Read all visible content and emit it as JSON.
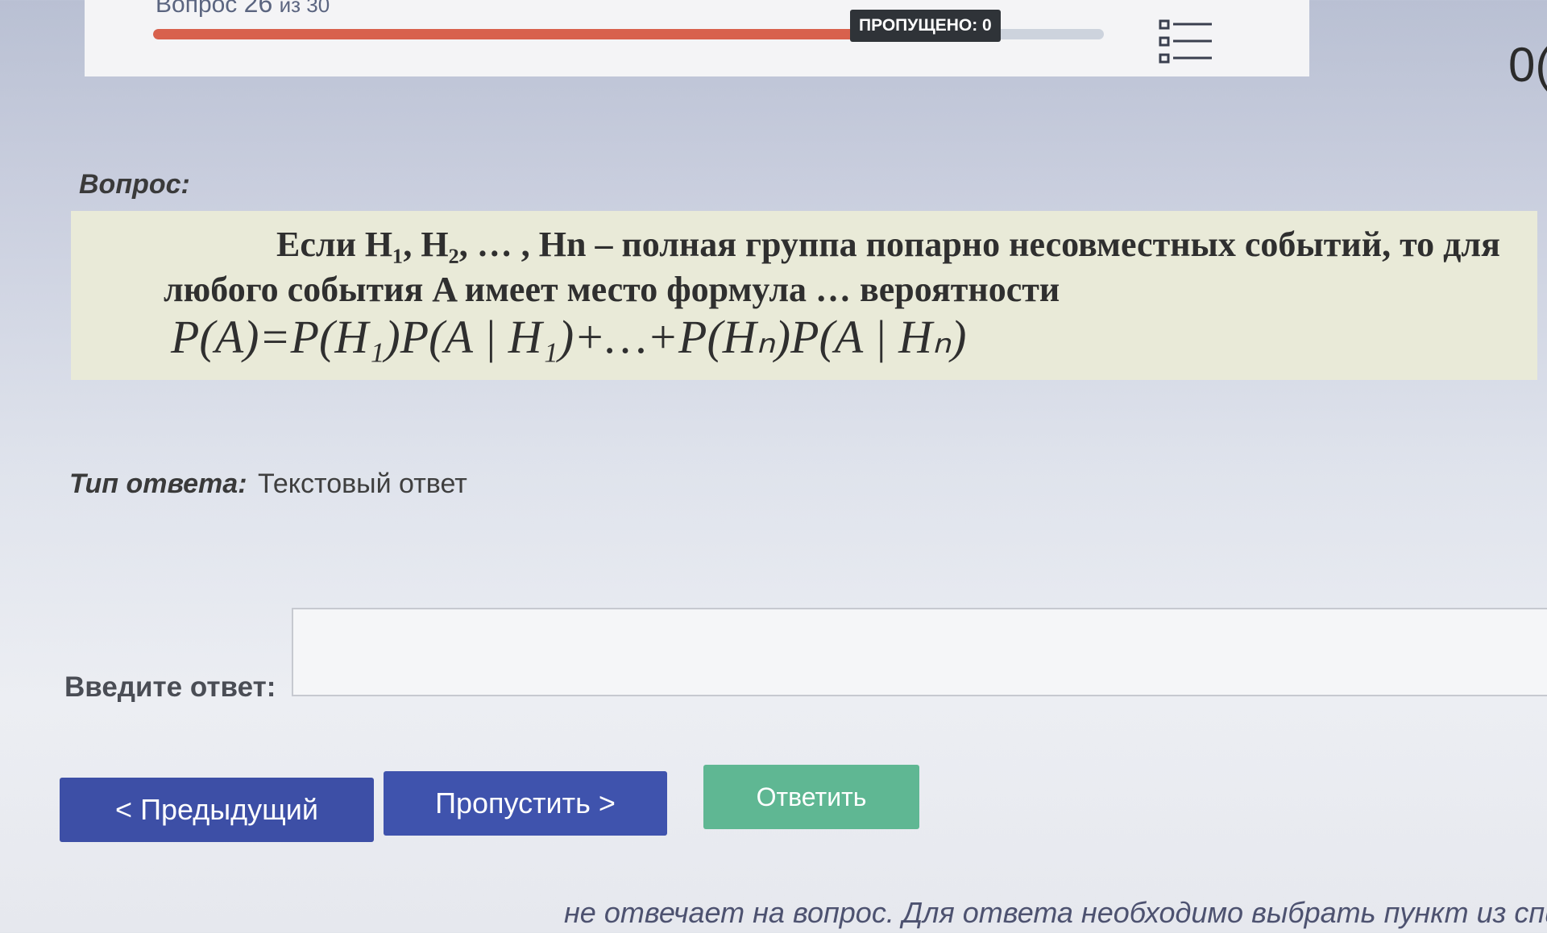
{
  "header": {
    "counter_word": "Вопрос",
    "counter_current": "26",
    "counter_of": "из 30",
    "skipped_badge": "ПРОПУЩЕНО: 0",
    "progress_fraction": 0.84,
    "timer_partial": "0("
  },
  "question": {
    "label": "Вопрос:",
    "text": "Если H₁, H₂, … , Hn – полная группа попарно несовместных событий, то для любого события A имеет место формула … вероятности",
    "formula": "P(A)=P(H₁)P(A | H₁)+…+P(Hₙ)P(A | Hₙ)"
  },
  "answer_type": {
    "label": "Тип ответа:",
    "value": "Текстовый ответ"
  },
  "answer_input": {
    "label": "Введите ответ:",
    "value": "",
    "placeholder": ""
  },
  "buttons": {
    "prev": "< Предыдущий",
    "skip": "Пропустить >",
    "answer": "Ответить"
  },
  "footer": {
    "hint": "не отвечает на вопрос. Для ответа необходимо выбрать пункт из спи"
  },
  "colors": {
    "progress_fill": "#d8614d",
    "progress_track": "#cdd3dd",
    "primary_button": "#3d4fa6",
    "answer_button": "#5fb793",
    "question_bg": "#e9ead8"
  },
  "icons": [
    "list-icon"
  ]
}
